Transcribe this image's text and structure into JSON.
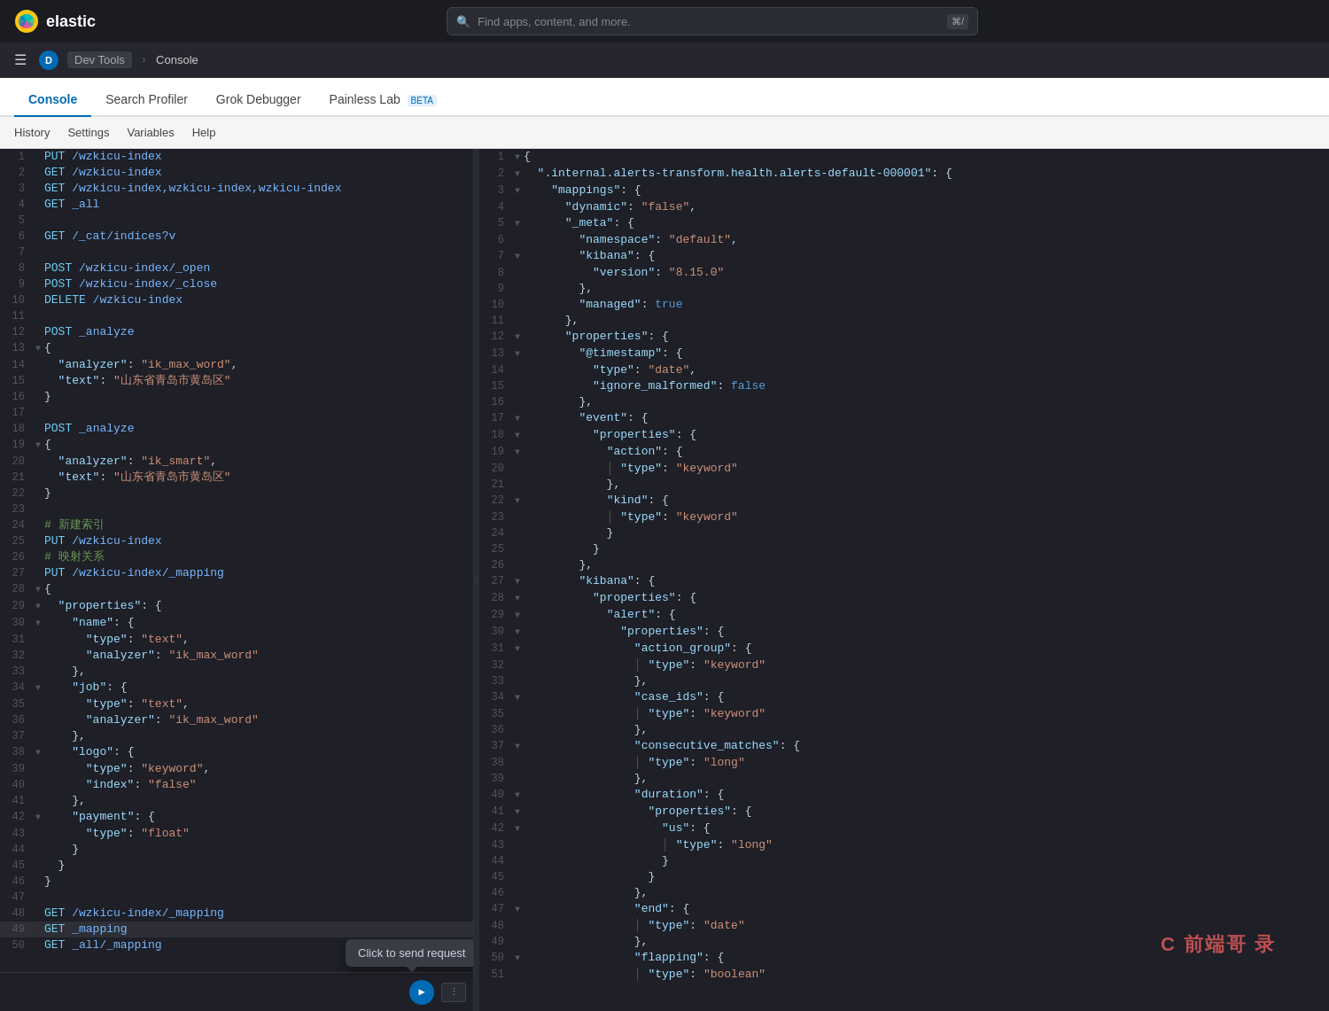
{
  "topbar": {
    "brand": "elastic",
    "search_placeholder": "Find apps, content, and more.",
    "shortcut": "⌘/",
    "avatar_label": "D",
    "breadcrumb_dev_tools": "Dev Tools",
    "breadcrumb_console": "Console"
  },
  "tabs": [
    {
      "id": "console",
      "label": "Console",
      "active": true,
      "beta": false
    },
    {
      "id": "search-profiler",
      "label": "Search Profiler",
      "active": false,
      "beta": false
    },
    {
      "id": "grok-debugger",
      "label": "Grok Debugger",
      "active": false,
      "beta": false
    },
    {
      "id": "painless-lab",
      "label": "Painless Lab",
      "active": false,
      "beta": true
    }
  ],
  "subtoolbar": [
    {
      "id": "history",
      "label": "History"
    },
    {
      "id": "settings",
      "label": "Settings"
    },
    {
      "id": "variables",
      "label": "Variables"
    },
    {
      "id": "help",
      "label": "Help"
    }
  ],
  "tooltip": {
    "text": "Click to send request"
  },
  "left_lines": [
    {
      "num": 1,
      "fold": "",
      "content": "PUT /wzkicu-index",
      "class": "c-method"
    },
    {
      "num": 2,
      "fold": "",
      "content": "GET /wzkicu-index",
      "class": "c-method"
    },
    {
      "num": 3,
      "fold": "",
      "content": "GET /wzkicu-index,wzkicu-index,wzkicu-index",
      "class": "c-method"
    },
    {
      "num": 4,
      "fold": "",
      "content": "GET _all",
      "class": "c-method"
    },
    {
      "num": 5,
      "fold": "",
      "content": "",
      "class": ""
    },
    {
      "num": 6,
      "fold": "",
      "content": "GET /_cat/indices?v",
      "class": "c-method"
    },
    {
      "num": 7,
      "fold": "",
      "content": "",
      "class": ""
    },
    {
      "num": 8,
      "fold": "",
      "content": "POST /wzkicu-index/_open",
      "class": "c-method"
    },
    {
      "num": 9,
      "fold": "",
      "content": "POST /wzkicu-index/_close",
      "class": "c-method"
    },
    {
      "num": 10,
      "fold": "",
      "content": "DELETE /wzkicu-index",
      "class": "c-method"
    },
    {
      "num": 11,
      "fold": "",
      "content": "",
      "class": ""
    },
    {
      "num": 12,
      "fold": "",
      "content": "POST _analyze",
      "class": "c-method"
    },
    {
      "num": 13,
      "fold": "▼",
      "content": "{",
      "class": "c-brace"
    },
    {
      "num": 14,
      "fold": "",
      "content": "  \"analyzer\": \"ik_max_word\",",
      "class": ""
    },
    {
      "num": 15,
      "fold": "",
      "content": "  \"text\": \"山东省青岛市黄岛区\"",
      "class": ""
    },
    {
      "num": 16,
      "fold": "",
      "content": "}",
      "class": "c-brace"
    },
    {
      "num": 17,
      "fold": "",
      "content": "",
      "class": ""
    },
    {
      "num": 18,
      "fold": "",
      "content": "POST _analyze",
      "class": "c-method"
    },
    {
      "num": 19,
      "fold": "▼",
      "content": "{",
      "class": "c-brace"
    },
    {
      "num": 20,
      "fold": "",
      "content": "  \"analyzer\": \"ik_smart\",",
      "class": ""
    },
    {
      "num": 21,
      "fold": "",
      "content": "  \"text\": \"山东省青岛市黄岛区\"",
      "class": ""
    },
    {
      "num": 22,
      "fold": "",
      "content": "}",
      "class": "c-brace"
    },
    {
      "num": 23,
      "fold": "",
      "content": "",
      "class": ""
    },
    {
      "num": 24,
      "fold": "",
      "content": "# 新建索引",
      "class": "c-comment"
    },
    {
      "num": 25,
      "fold": "",
      "content": "PUT /wzkicu-index",
      "class": "c-method"
    },
    {
      "num": 26,
      "fold": "",
      "content": "# 映射关系",
      "class": "c-comment"
    },
    {
      "num": 27,
      "fold": "",
      "content": "PUT /wzkicu-index/_mapping",
      "class": "c-method"
    },
    {
      "num": 28,
      "fold": "▼",
      "content": "{",
      "class": "c-brace"
    },
    {
      "num": 29,
      "fold": "▼",
      "content": "  \"properties\": {",
      "class": ""
    },
    {
      "num": 30,
      "fold": "▼",
      "content": "    \"name\": {",
      "class": ""
    },
    {
      "num": 31,
      "fold": "",
      "content": "      \"type\": \"text\",",
      "class": ""
    },
    {
      "num": 32,
      "fold": "",
      "content": "      \"analyzer\": \"ik_max_word\"",
      "class": ""
    },
    {
      "num": 33,
      "fold": "",
      "content": "    },",
      "class": ""
    },
    {
      "num": 34,
      "fold": "▼",
      "content": "    \"job\": {",
      "class": ""
    },
    {
      "num": 35,
      "fold": "",
      "content": "      \"type\": \"text\",",
      "class": ""
    },
    {
      "num": 36,
      "fold": "",
      "content": "      \"analyzer\": \"ik_max_word\"",
      "class": ""
    },
    {
      "num": 37,
      "fold": "",
      "content": "    },",
      "class": ""
    },
    {
      "num": 38,
      "fold": "▼",
      "content": "    \"logo\": {",
      "class": ""
    },
    {
      "num": 39,
      "fold": "",
      "content": "      \"type\": \"keyword\",",
      "class": ""
    },
    {
      "num": 40,
      "fold": "",
      "content": "      \"index\": \"false\"",
      "class": ""
    },
    {
      "num": 41,
      "fold": "",
      "content": "    },",
      "class": ""
    },
    {
      "num": 42,
      "fold": "▼",
      "content": "    \"payment\": {",
      "class": ""
    },
    {
      "num": 43,
      "fold": "",
      "content": "      \"type\": \"float\"",
      "class": ""
    },
    {
      "num": 44,
      "fold": "",
      "content": "    }",
      "class": ""
    },
    {
      "num": 45,
      "fold": "",
      "content": "  }",
      "class": ""
    },
    {
      "num": 46,
      "fold": "",
      "content": "}",
      "class": "c-brace"
    },
    {
      "num": 47,
      "fold": "",
      "content": "",
      "class": ""
    },
    {
      "num": 48,
      "fold": "",
      "content": "GET /wzkicu-index/_mapping",
      "class": "c-method"
    },
    {
      "num": 49,
      "fold": "",
      "content": "GET _mapping",
      "class": "c-method-active"
    },
    {
      "num": 50,
      "fold": "",
      "content": "GET _all/_mapping",
      "class": "c-method"
    }
  ],
  "right_lines": [
    {
      "num": 1,
      "fold": "▼",
      "content": "{"
    },
    {
      "num": 2,
      "fold": "▼",
      "content": "  \".internal.alerts-transform.health.alerts-default-000001\": {"
    },
    {
      "num": 3,
      "fold": "▼",
      "content": "    \"mappings\": {"
    },
    {
      "num": 4,
      "fold": "",
      "content": "      \"dynamic\": \"false\","
    },
    {
      "num": 5,
      "fold": "▼",
      "content": "      \"_meta\": {"
    },
    {
      "num": 6,
      "fold": "",
      "content": "        \"namespace\": \"default\","
    },
    {
      "num": 7,
      "fold": "▼",
      "content": "        \"kibana\": {"
    },
    {
      "num": 8,
      "fold": "",
      "content": "          \"version\": \"8.15.0\""
    },
    {
      "num": 9,
      "fold": "",
      "content": "        },"
    },
    {
      "num": 10,
      "fold": "",
      "content": "        \"managed\": true"
    },
    {
      "num": 11,
      "fold": "",
      "content": "      },"
    },
    {
      "num": 12,
      "fold": "▼",
      "content": "      \"properties\": {"
    },
    {
      "num": 13,
      "fold": "▼",
      "content": "        \"@timestamp\": {"
    },
    {
      "num": 14,
      "fold": "",
      "content": "          \"type\": \"date\","
    },
    {
      "num": 15,
      "fold": "",
      "content": "          \"ignore_malformed\": false"
    },
    {
      "num": 16,
      "fold": "",
      "content": "        },"
    },
    {
      "num": 17,
      "fold": "▼",
      "content": "        \"event\": {"
    },
    {
      "num": 18,
      "fold": "▼",
      "content": "          \"properties\": {"
    },
    {
      "num": 19,
      "fold": "▼",
      "content": "            \"action\": {"
    },
    {
      "num": 20,
      "fold": "",
      "content": "            | \"type\": \"keyword\""
    },
    {
      "num": 21,
      "fold": "",
      "content": "            },"
    },
    {
      "num": 22,
      "fold": "▼",
      "content": "            \"kind\": {"
    },
    {
      "num": 23,
      "fold": "",
      "content": "            | \"type\": \"keyword\""
    },
    {
      "num": 24,
      "fold": "",
      "content": "            }"
    },
    {
      "num": 25,
      "fold": "",
      "content": "          }"
    },
    {
      "num": 26,
      "fold": "",
      "content": "        },"
    },
    {
      "num": 27,
      "fold": "▼",
      "content": "        \"kibana\": {"
    },
    {
      "num": 28,
      "fold": "▼",
      "content": "          \"properties\": {"
    },
    {
      "num": 29,
      "fold": "▼",
      "content": "            \"alert\": {"
    },
    {
      "num": 30,
      "fold": "▼",
      "content": "              \"properties\": {"
    },
    {
      "num": 31,
      "fold": "▼",
      "content": "                \"action_group\": {"
    },
    {
      "num": 32,
      "fold": "",
      "content": "                | \"type\": \"keyword\""
    },
    {
      "num": 33,
      "fold": "",
      "content": "                },"
    },
    {
      "num": 34,
      "fold": "▼",
      "content": "                \"case_ids\": {"
    },
    {
      "num": 35,
      "fold": "",
      "content": "                | \"type\": \"keyword\""
    },
    {
      "num": 36,
      "fold": "",
      "content": "                },"
    },
    {
      "num": 37,
      "fold": "▼",
      "content": "                \"consecutive_matches\": {"
    },
    {
      "num": 38,
      "fold": "",
      "content": "                | \"type\": \"long\""
    },
    {
      "num": 39,
      "fold": "",
      "content": "                },"
    },
    {
      "num": 40,
      "fold": "▼",
      "content": "                \"duration\": {"
    },
    {
      "num": 41,
      "fold": "▼",
      "content": "                  \"properties\": {"
    },
    {
      "num": 42,
      "fold": "▼",
      "content": "                    \"us\": {"
    },
    {
      "num": 43,
      "fold": "",
      "content": "                    | \"type\": \"long\""
    },
    {
      "num": 44,
      "fold": "",
      "content": "                    }"
    },
    {
      "num": 45,
      "fold": "",
      "content": "                  }"
    },
    {
      "num": 46,
      "fold": "",
      "content": "                },"
    },
    {
      "num": 47,
      "fold": "▼",
      "content": "                \"end\": {"
    },
    {
      "num": 48,
      "fold": "",
      "content": "                | \"type\": \"date\""
    },
    {
      "num": 49,
      "fold": "",
      "content": "                },"
    },
    {
      "num": 50,
      "fold": "▼",
      "content": "                \"flapping\": {"
    },
    {
      "num": 51,
      "fold": "",
      "content": "                | \"type\": \"boolean\""
    }
  ]
}
